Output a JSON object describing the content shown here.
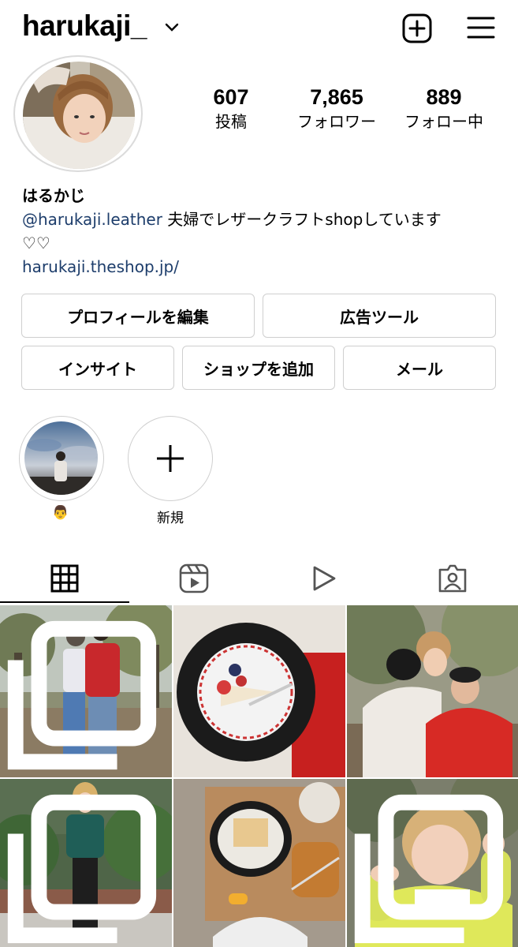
{
  "header": {
    "username": "harukaji_"
  },
  "stats": [
    {
      "value": "607",
      "label": "投稿"
    },
    {
      "value": "7,865",
      "label": "フォロワー"
    },
    {
      "value": "889",
      "label": "フォロー中"
    }
  ],
  "bio": {
    "name": "はるかじ",
    "mention": "@harukaji.leather",
    "text": " 夫婦でレザークラフトshopしています",
    "hearts": "♡♡",
    "link": "harukaji.theshop.jp/"
  },
  "buttons": {
    "edit_profile": "プロフィールを編集",
    "ad_tools": "広告ツール",
    "insights": "インサイト",
    "add_shop": "ショップを追加",
    "email": "メール"
  },
  "highlights": [
    {
      "label": "👨"
    },
    {
      "label": "新規"
    }
  ],
  "icons": {
    "header": [
      "chevron-down-icon",
      "new-post-icon",
      "menu-icon"
    ],
    "tabs": [
      "grid-icon",
      "reels-icon",
      "video-icon",
      "tagged-icon"
    ],
    "multi_post": "multi-post-icon"
  }
}
